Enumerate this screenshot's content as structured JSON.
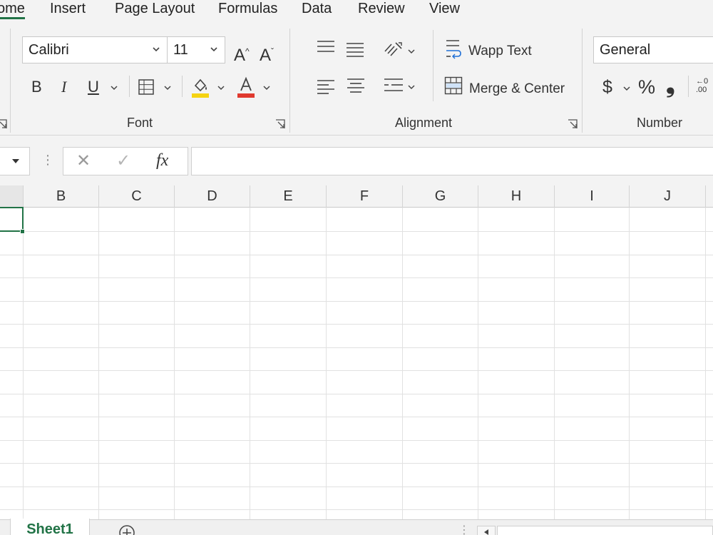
{
  "menu": {
    "tabs": [
      "ome",
      "Insert",
      "Page Layout",
      "Formulas",
      "Data",
      "Review",
      "View"
    ]
  },
  "ribbon": {
    "font": {
      "name": "Calibri",
      "size": "11",
      "label": "Font"
    },
    "alignment": {
      "wrap_label": "Wapp Text",
      "merge_label": "Merge & Center",
      "label": "Alignment"
    },
    "number": {
      "format": "General",
      "label": "Number",
      "currency_symbol": "$",
      "percent_symbol": "%",
      "comma_symbol": "❟",
      "decimal_glyph": "←0 .00"
    },
    "icons": {
      "bold": "B",
      "italic": "I",
      "underline": "U",
      "grow": "A",
      "shrink": "A"
    },
    "colors": {
      "highlight": "#f5d312",
      "font_color": "#e03a2f"
    }
  },
  "formula_bar": {
    "cancel_glyph": "✕",
    "enter_glyph": "✓",
    "fx_glyph": "fx",
    "more_glyph": "⋮",
    "value": ""
  },
  "grid": {
    "columns": [
      "B",
      "C",
      "D",
      "E",
      "F",
      "G",
      "H",
      "I",
      "J"
    ]
  },
  "sheets": {
    "active": "Sheet1",
    "add_glyph": "+"
  },
  "theme": {
    "accent": "#217346"
  }
}
